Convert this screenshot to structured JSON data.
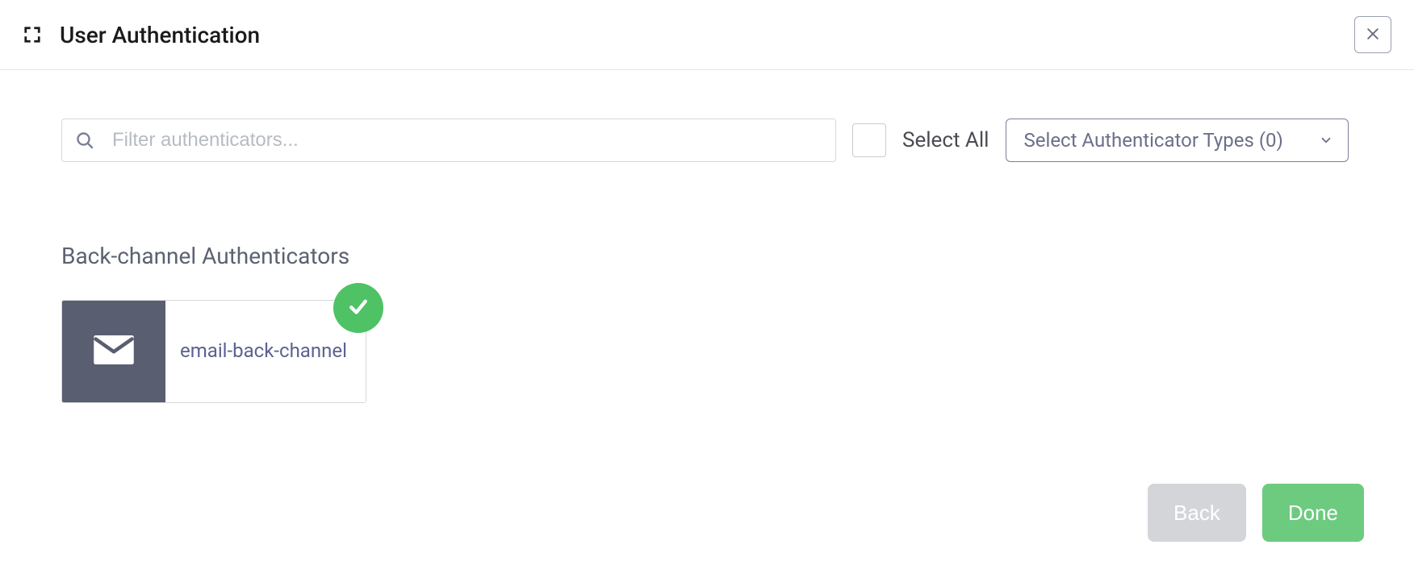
{
  "header": {
    "title": "User Authentication"
  },
  "filter": {
    "placeholder": "Filter authenticators...",
    "value": "",
    "selectAllLabel": "Select All",
    "typeDropdownLabel": "Select Authenticator Types (0)"
  },
  "section": {
    "title": "Back-channel Authenticators"
  },
  "authenticators": [
    {
      "name": "email-back-channel",
      "icon": "envelope-icon",
      "selected": true
    }
  ],
  "footer": {
    "backLabel": "Back",
    "doneLabel": "Done"
  }
}
